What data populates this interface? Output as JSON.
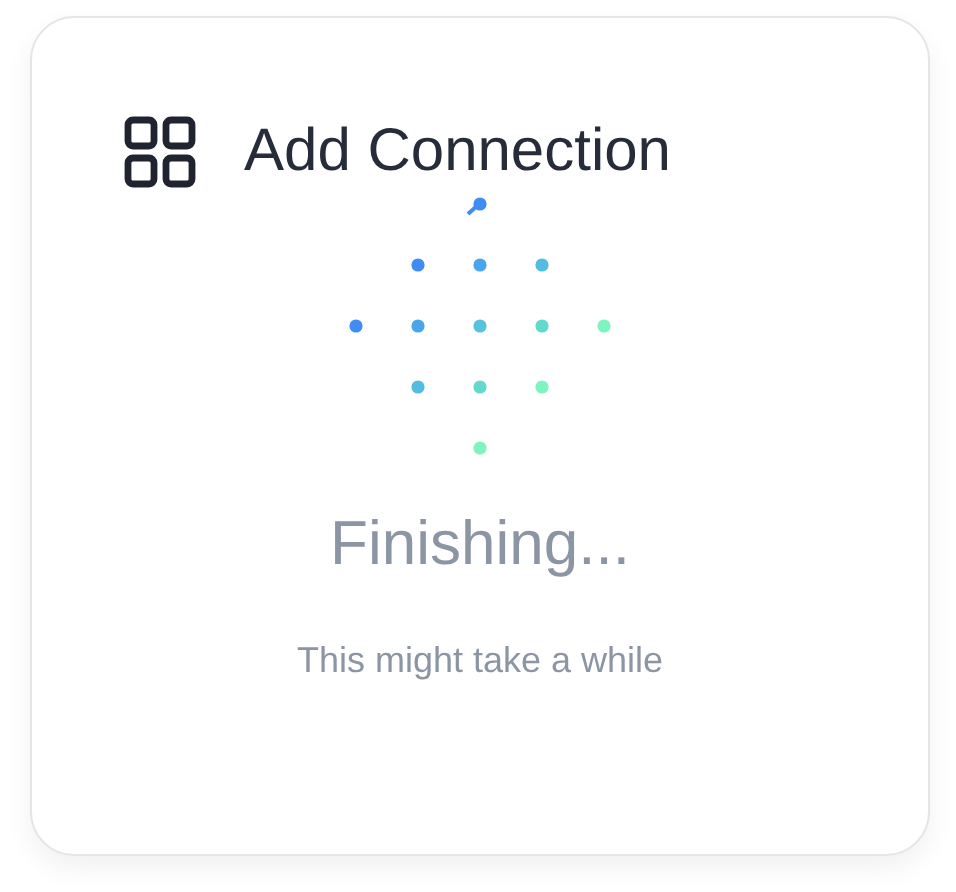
{
  "dialog": {
    "title": "Add Connection",
    "status": "Finishing...",
    "message": "This might take a while"
  }
}
